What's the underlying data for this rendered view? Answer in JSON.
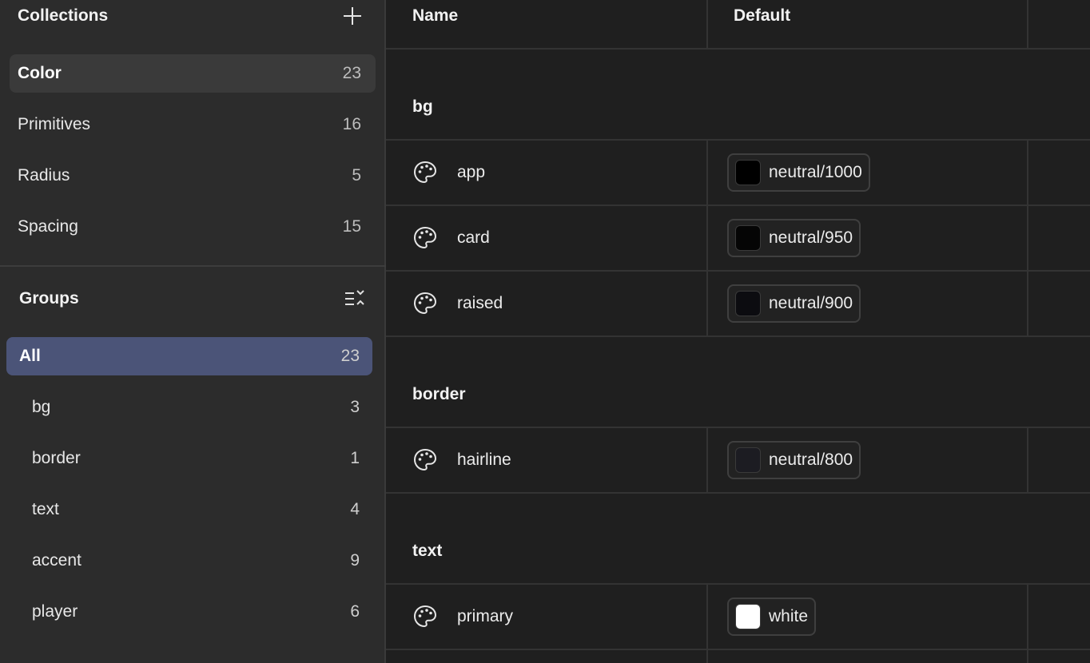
{
  "sidebar": {
    "collections": {
      "title": "Collections",
      "add_icon": "plus-icon",
      "items": [
        {
          "label": "Color",
          "count": "23",
          "selected": true
        },
        {
          "label": "Primitives",
          "count": "16"
        },
        {
          "label": "Radius",
          "count": "5"
        },
        {
          "label": "Spacing",
          "count": "15"
        }
      ]
    },
    "groups": {
      "title": "Groups",
      "collapse_icon": "collapse-all-icon",
      "items": [
        {
          "label": "All",
          "count": "23",
          "selected": true
        },
        {
          "label": "bg",
          "count": "3"
        },
        {
          "label": "border",
          "count": "1"
        },
        {
          "label": "text",
          "count": "4"
        },
        {
          "label": "accent",
          "count": "9"
        },
        {
          "label": "player",
          "count": "6"
        }
      ]
    }
  },
  "table": {
    "columns": {
      "name": "Name",
      "default": "Default"
    },
    "groups": [
      {
        "name": "bg",
        "rows": [
          {
            "icon": "palette-icon",
            "name": "app",
            "value": "neutral/1000",
            "swatch": "#000000"
          },
          {
            "icon": "palette-icon",
            "name": "card",
            "value": "neutral/950",
            "swatch": "#050505"
          },
          {
            "icon": "palette-icon",
            "name": "raised",
            "value": "neutral/900",
            "swatch": "#0c0c10"
          }
        ]
      },
      {
        "name": "border",
        "rows": [
          {
            "icon": "palette-icon",
            "name": "hairline",
            "value": "neutral/800",
            "swatch": "#1c1c22"
          }
        ]
      },
      {
        "name": "text",
        "rows": [
          {
            "icon": "palette-icon",
            "name": "primary",
            "value": "white",
            "swatch": "#ffffff"
          }
        ]
      }
    ]
  },
  "colors": {
    "sidebar_bg": "#2c2c2c",
    "main_bg": "#1f1f1f",
    "selected_group_bg": "#4b5478",
    "selected_collection_bg": "#3a3a3a"
  }
}
